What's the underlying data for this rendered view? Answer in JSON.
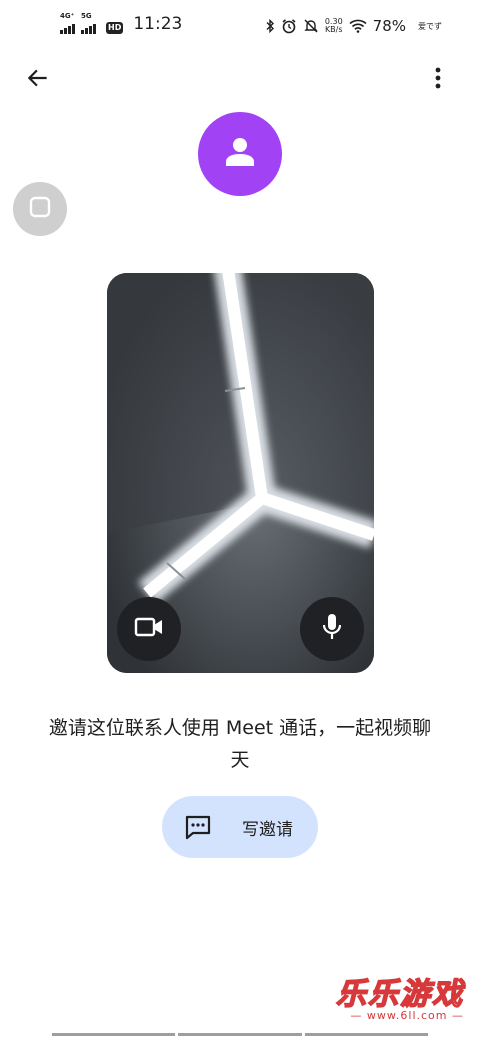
{
  "status_bar": {
    "network_1": "4G⁺",
    "network_2": "5G",
    "hd_badge": "HD",
    "time": "11:23",
    "speed_value": "0.30",
    "speed_unit": "KB/s",
    "battery": "78%",
    "carrier": "爱でず"
  },
  "icons": {
    "back": "arrow-back-icon",
    "more": "more-vert-icon",
    "avatar": "person-icon",
    "floating": "square-icon",
    "camera": "videocam-icon",
    "mic": "mic-icon",
    "message": "message-icon"
  },
  "colors": {
    "avatar_bg": "#a142f4",
    "button_bg": "#d3e3fd",
    "control_bg": "#202124"
  },
  "invite": {
    "text": "邀请这位联系人使用 Meet 通话，一起视频聊天"
  },
  "write_button": {
    "label": "写邀请"
  },
  "watermark": {
    "title": "乐乐游戏",
    "url": "— www.6ll.com —"
  }
}
